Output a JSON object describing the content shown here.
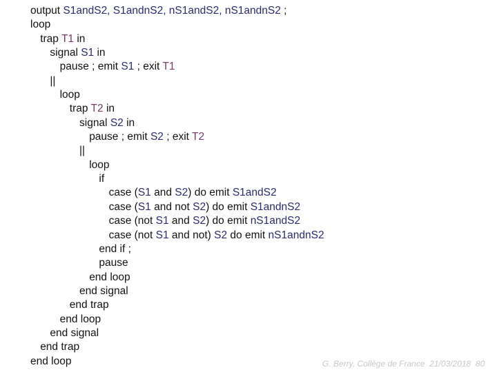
{
  "colors": {
    "text": "#111111",
    "signal": "#2a2a6e",
    "trap": "#7a3a6a",
    "footer": "#c8c8c8",
    "background": "#ffffff"
  },
  "code": [
    {
      "indent": 0,
      "tokens": [
        {
          "t": "output ",
          "k": "kw"
        },
        {
          "t": "S1andS2, S1andnS2, nS1andS2, nS1andnS2",
          "k": "sig"
        },
        {
          "t": " ;",
          "k": "kw"
        }
      ]
    },
    {
      "indent": 0,
      "tokens": [
        {
          "t": "loop",
          "k": "kw"
        }
      ]
    },
    {
      "indent": 1,
      "tokens": [
        {
          "t": "trap ",
          "k": "kw"
        },
        {
          "t": "T1",
          "k": "trap"
        },
        {
          "t": " in",
          "k": "kw"
        }
      ]
    },
    {
      "indent": 2,
      "tokens": [
        {
          "t": "signal ",
          "k": "kw"
        },
        {
          "t": "S1",
          "k": "sig"
        },
        {
          "t": " in",
          "k": "kw"
        }
      ]
    },
    {
      "indent": 3,
      "tokens": [
        {
          "t": "pause ; emit ",
          "k": "kw"
        },
        {
          "t": "S1",
          "k": "sig"
        },
        {
          "t": " ; exit ",
          "k": "kw"
        },
        {
          "t": "T1",
          "k": "trap"
        }
      ]
    },
    {
      "indent": 2,
      "tokens": [
        {
          "t": "||",
          "k": "kw"
        }
      ]
    },
    {
      "indent": 3,
      "tokens": [
        {
          "t": "loop",
          "k": "kw"
        }
      ]
    },
    {
      "indent": 4,
      "tokens": [
        {
          "t": "trap ",
          "k": "kw"
        },
        {
          "t": "T2",
          "k": "trap"
        },
        {
          "t": " in",
          "k": "kw"
        }
      ]
    },
    {
      "indent": 5,
      "tokens": [
        {
          "t": "signal ",
          "k": "kw"
        },
        {
          "t": "S2",
          "k": "sig"
        },
        {
          "t": " in",
          "k": "kw"
        }
      ]
    },
    {
      "indent": 6,
      "tokens": [
        {
          "t": "pause ; emit ",
          "k": "kw"
        },
        {
          "t": "S2",
          "k": "sig"
        },
        {
          "t": " ; exit ",
          "k": "kw"
        },
        {
          "t": "T2",
          "k": "trap"
        }
      ]
    },
    {
      "indent": 5,
      "tokens": [
        {
          "t": "||",
          "k": "kw"
        }
      ]
    },
    {
      "indent": 6,
      "tokens": [
        {
          "t": "loop",
          "k": "kw"
        }
      ]
    },
    {
      "indent": 7,
      "tokens": [
        {
          "t": "if",
          "k": "kw"
        }
      ]
    },
    {
      "indent": 8,
      "tokens": [
        {
          "t": "case (",
          "k": "kw"
        },
        {
          "t": "S1",
          "k": "sig"
        },
        {
          "t": " and ",
          "k": "kw"
        },
        {
          "t": "S2",
          "k": "sig"
        },
        {
          "t": ") do emit ",
          "k": "kw"
        },
        {
          "t": "S1andS2",
          "k": "sig"
        }
      ]
    },
    {
      "indent": 8,
      "tokens": [
        {
          "t": "case (",
          "k": "kw"
        },
        {
          "t": "S1",
          "k": "sig"
        },
        {
          "t": " and not ",
          "k": "kw"
        },
        {
          "t": "S2",
          "k": "sig"
        },
        {
          "t": ") do emit ",
          "k": "kw"
        },
        {
          "t": "S1andnS2",
          "k": "sig"
        }
      ]
    },
    {
      "indent": 8,
      "tokens": [
        {
          "t": "case (not ",
          "k": "kw"
        },
        {
          "t": "S1",
          "k": "sig"
        },
        {
          "t": " and ",
          "k": "kw"
        },
        {
          "t": "S2",
          "k": "sig"
        },
        {
          "t": ") do emit ",
          "k": "kw"
        },
        {
          "t": "nS1andS2",
          "k": "sig"
        }
      ]
    },
    {
      "indent": 8,
      "tokens": [
        {
          "t": "case (not ",
          "k": "kw"
        },
        {
          "t": "S1",
          "k": "sig"
        },
        {
          "t": " and not) ",
          "k": "kw"
        },
        {
          "t": "S2",
          "k": "sig"
        },
        {
          "t": " do emit ",
          "k": "kw"
        },
        {
          "t": "nS1andnS2",
          "k": "sig"
        }
      ]
    },
    {
      "indent": 7,
      "tokens": [
        {
          "t": "end if ;",
          "k": "kw"
        }
      ]
    },
    {
      "indent": 7,
      "tokens": [
        {
          "t": "pause",
          "k": "kw"
        }
      ]
    },
    {
      "indent": 6,
      "tokens": [
        {
          "t": "end loop",
          "k": "kw"
        }
      ]
    },
    {
      "indent": 5,
      "tokens": [
        {
          "t": "end signal",
          "k": "kw"
        }
      ]
    },
    {
      "indent": 4,
      "tokens": [
        {
          "t": "end trap",
          "k": "kw"
        }
      ]
    },
    {
      "indent": 3,
      "tokens": [
        {
          "t": "end loop",
          "k": "kw"
        }
      ]
    },
    {
      "indent": 2,
      "tokens": [
        {
          "t": "end signal",
          "k": "kw"
        }
      ]
    },
    {
      "indent": 1,
      "tokens": [
        {
          "t": "end trap",
          "k": "kw"
        }
      ]
    },
    {
      "indent": 0,
      "tokens": [
        {
          "t": "end loop",
          "k": "kw"
        }
      ]
    }
  ],
  "footer": {
    "text": "G. Berry, Collège de France  21/03/2018  80"
  }
}
